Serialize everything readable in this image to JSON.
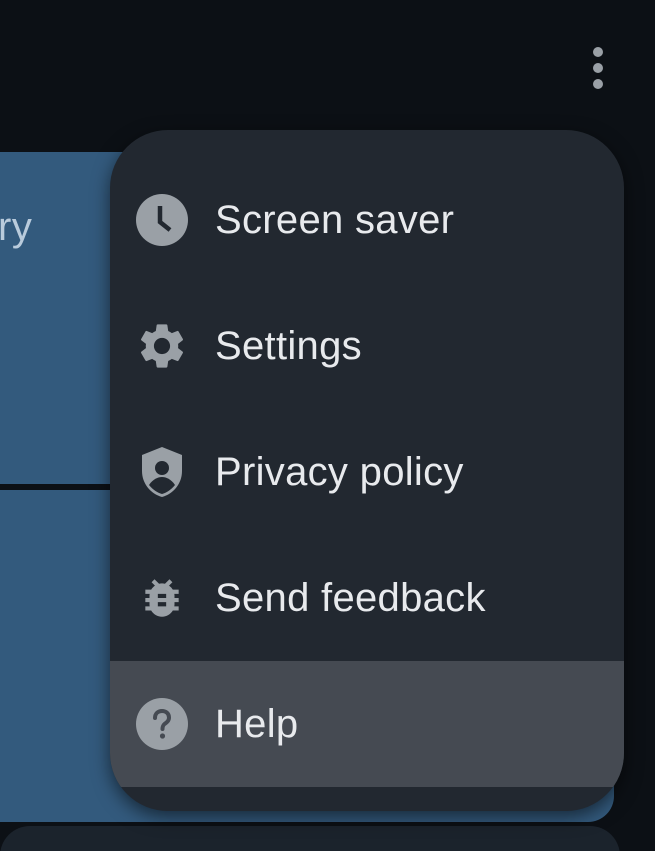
{
  "app_bar": {
    "overflow_icon": "more-vert-icon"
  },
  "background": {
    "card_text_fragment": "ry"
  },
  "menu": {
    "items": [
      {
        "label": "Screen saver",
        "icon": "clock-icon"
      },
      {
        "label": "Settings",
        "icon": "gear-icon"
      },
      {
        "label": "Privacy policy",
        "icon": "shield-person-icon"
      },
      {
        "label": "Send feedback",
        "icon": "bug-icon"
      },
      {
        "label": "Help",
        "icon": "help-circle-icon"
      }
    ],
    "highlighted_item": "Help"
  },
  "colors": {
    "background": "#0c1015",
    "card": "#335a7d",
    "menu_surface": "#222830",
    "menu_highlight": "#454a52",
    "text": "#e8eaed",
    "icon": "#9aa0a6"
  }
}
